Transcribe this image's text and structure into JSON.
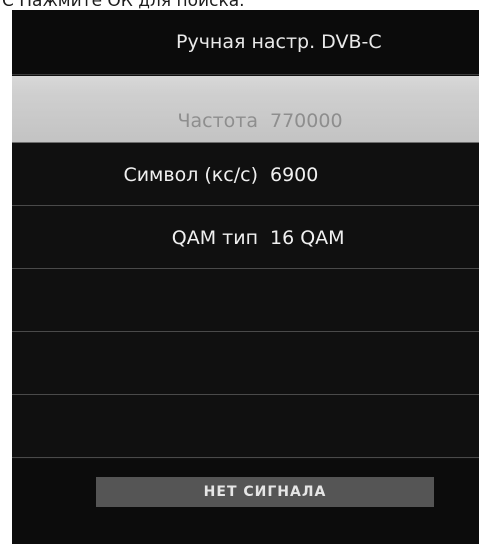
{
  "hint": {
    "text": "С Нажмите ОК для поиска."
  },
  "menu": {
    "title": "Ручная настр. DVB-C",
    "rows": [
      {
        "label": "Частота",
        "value": "770000",
        "selected": true
      },
      {
        "label": "Символ (кс/с)",
        "value": "6900",
        "selected": false
      },
      {
        "label": "QAM тип",
        "value": "16 QAM",
        "selected": false
      },
      {
        "label": "",
        "value": "",
        "selected": false
      },
      {
        "label": "",
        "value": "",
        "selected": false
      },
      {
        "label": "",
        "value": "",
        "selected": false
      }
    ]
  },
  "status": {
    "text": "НЕТ СИГНАЛА"
  },
  "colors": {
    "background": "#101010",
    "selected_row": "#cfcfcf",
    "status_bar": "#555555",
    "text": "#f0f0f0"
  }
}
